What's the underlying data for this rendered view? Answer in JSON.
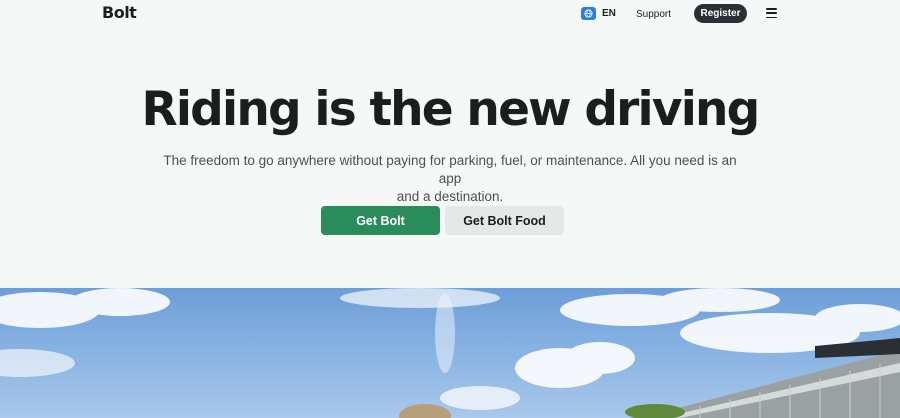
{
  "header": {
    "logo": "Bolt",
    "language": {
      "code": "EN",
      "icon": "globe-icon"
    },
    "support_label": "Support",
    "register_label": "Register",
    "menu_icon": "hamburger-menu-icon"
  },
  "hero": {
    "title": "Riding is the new driving",
    "subtitle_line1": "The freedom to go anywhere without paying for parking, fuel, or maintenance. All you need is an app",
    "subtitle_line2": "and a destination.",
    "primary_button": "Get Bolt",
    "secondary_button": "Get Bolt Food"
  },
  "colors": {
    "brand_green": "#2a8c5a",
    "register_bg": "#2c2f36",
    "globe_blue": "#2f7ee2",
    "background": "#f6f7f7"
  }
}
